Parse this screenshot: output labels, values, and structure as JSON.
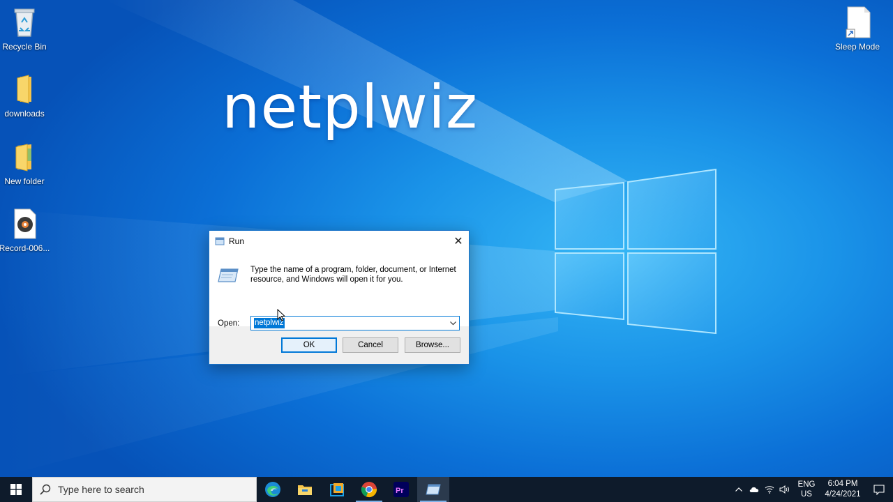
{
  "desktop": {
    "icons": [
      {
        "label": "Recycle Bin"
      },
      {
        "label": "downloads"
      },
      {
        "label": "New folder"
      },
      {
        "label": "Record-006..."
      },
      {
        "label": "Sleep Mode"
      }
    ],
    "overlay_text": "netplwiz"
  },
  "run_dialog": {
    "title": "Run",
    "description": "Type the name of a program, folder, document, or Internet resource, and Windows will open it for you.",
    "open_label": "Open:",
    "open_value": "netplwiz",
    "ok_label": "OK",
    "cancel_label": "Cancel",
    "browse_label": "Browse..."
  },
  "taskbar": {
    "search_placeholder": "Type here to search",
    "apps": [
      "edge-icon",
      "file-explorer-icon",
      "store-icon",
      "chrome-icon",
      "premiere-icon",
      "run-icon"
    ],
    "language": {
      "line1": "ENG",
      "line2": "US"
    },
    "clock": {
      "time": "6:04 PM",
      "date": "4/24/2021"
    }
  },
  "colors": {
    "accent": "#0078d7",
    "taskbar": "#0e1b2b"
  }
}
